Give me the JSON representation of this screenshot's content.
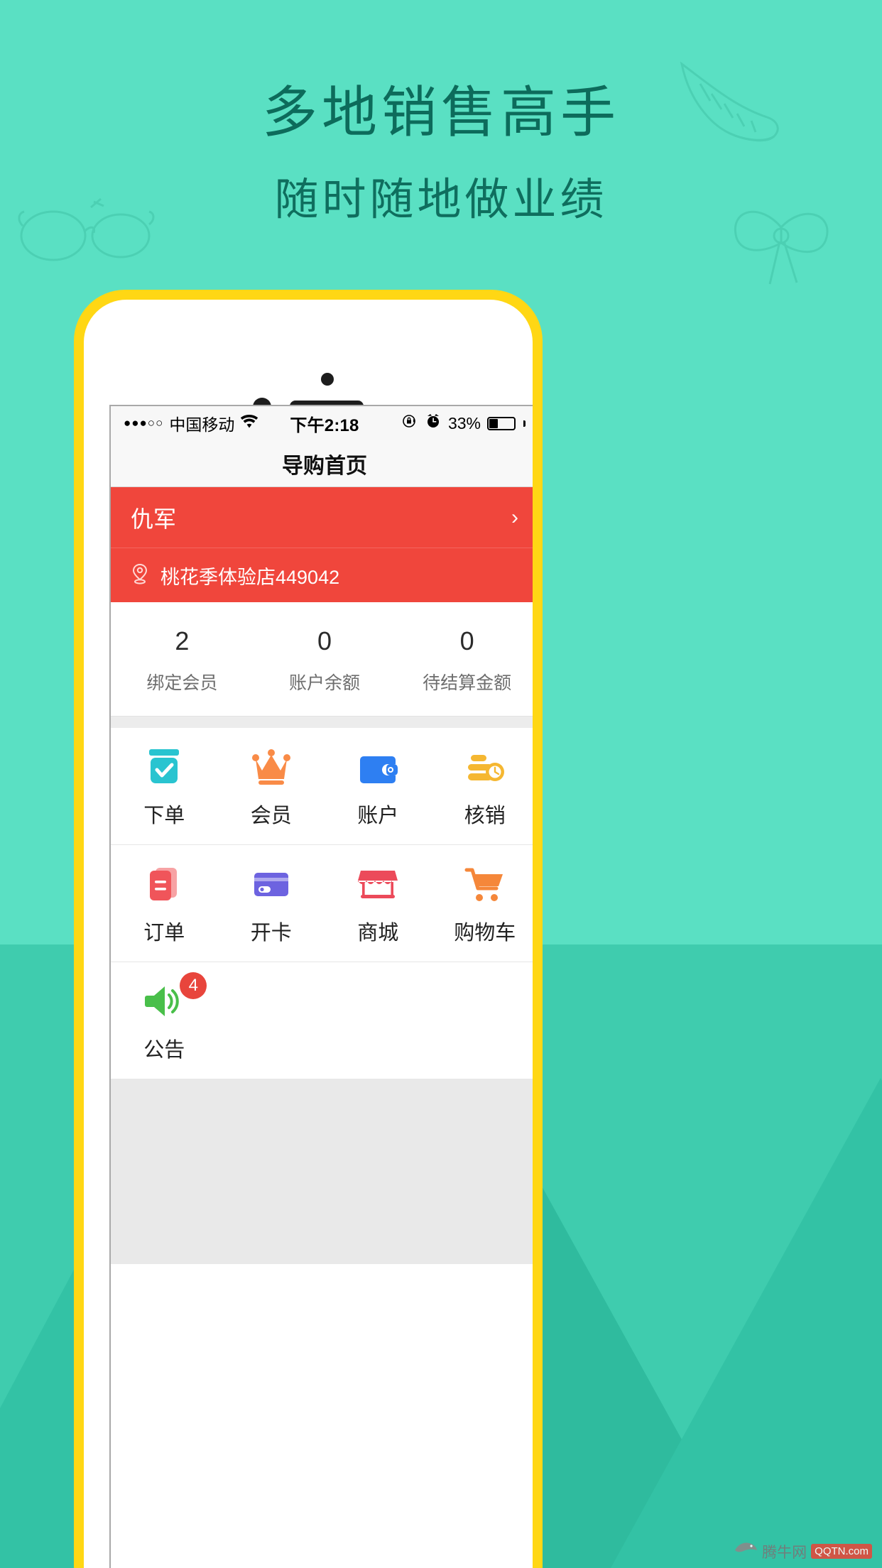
{
  "promo": {
    "headline": "多地销售高手",
    "subheadline": "随时随地做业绩",
    "bg_color_top": "#5ae0c3",
    "bg_color_bottom": "#33c2a5",
    "text_color": "#0d6b5b",
    "phone_frame_color": "#ffd714"
  },
  "status_bar": {
    "signal_dots": "●●●○○",
    "carrier": "中国移动",
    "wifi_icon": "wifi-icon",
    "time": "下午2:18",
    "lock_rotation_icon": "rotation-lock-icon",
    "alarm_icon": "alarm-clock-icon",
    "battery_percent": "33%",
    "battery_level": 33
  },
  "nav_bar": {
    "title": "导购首页"
  },
  "user_card": {
    "name": "仇军",
    "chevron": "›",
    "location_icon": "location-pin-icon",
    "store": "桃花季体验店449042",
    "background_color": "#f0463c"
  },
  "stats": [
    {
      "value": "2",
      "label": "绑定会员"
    },
    {
      "value": "0",
      "label": "账户余额"
    },
    {
      "value": "0",
      "label": "待结算金额"
    }
  ],
  "grid_rows": [
    [
      {
        "label": "下单",
        "icon": "checkbox-jar-icon",
        "color": "#29c4d0",
        "badge": null
      },
      {
        "label": "会员",
        "icon": "crown-icon",
        "color": "#f98b47",
        "badge": null
      },
      {
        "label": "账户",
        "icon": "wallet-icon",
        "color": "#2e7ff2",
        "badge": null
      },
      {
        "label": "核销",
        "icon": "coins-clock-icon",
        "color": "#f5b731",
        "badge": null
      }
    ],
    [
      {
        "label": "订单",
        "icon": "documents-icon",
        "color": "#f0555a",
        "badge": null
      },
      {
        "label": "开卡",
        "icon": "card-icon",
        "color": "#6d63e0",
        "badge": null
      },
      {
        "label": "商城",
        "icon": "storefront-icon",
        "color": "#ec4a5a",
        "badge": null
      },
      {
        "label": "购物车",
        "icon": "shopping-cart-icon",
        "color": "#f5873a",
        "badge": null
      }
    ],
    [
      {
        "label": "公告",
        "icon": "megaphone-icon",
        "color": "#49bf4a",
        "badge": "4"
      }
    ]
  ],
  "watermark": {
    "text": "腾牛网",
    "badge": "QQTN.com"
  }
}
